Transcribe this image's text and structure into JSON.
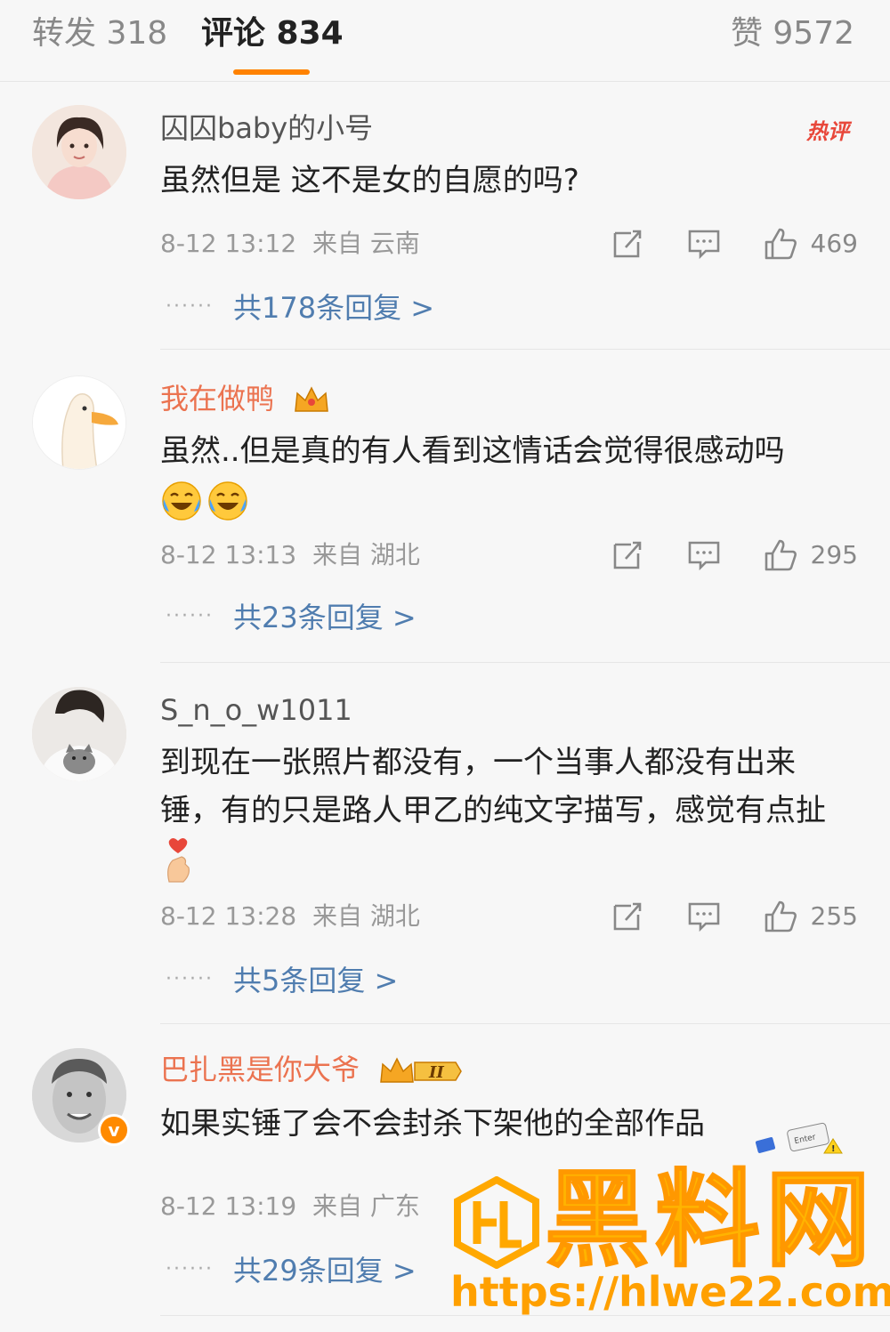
{
  "tabs": {
    "repost": "转发 318",
    "comments": "评论 834",
    "likes": "赞 9572"
  },
  "accent": "#ff8200",
  "comments": [
    {
      "username": "囚囚baby的小号",
      "hot_badge": "热评",
      "text": "虽然但是 这不是女的自愿的吗?",
      "time": "8-12 13:12",
      "source": "来自 云南",
      "likes": "469",
      "replies": "共178条回复 >"
    },
    {
      "username": "我在做鸭",
      "text": "虽然..但是真的有人看到这情话会觉得很感动吗",
      "time": "8-12 13:13",
      "source": "来自 湖北",
      "likes": "295",
      "replies": "共23条回复 >"
    },
    {
      "username": "S_n_o_w1011",
      "text": "到现在一张照片都没有，一个当事人都没有出来锤，有的只是路人甲乙的纯文字描写，感觉有点扯",
      "time": "8-12 13:28",
      "source": "来自 湖北",
      "likes": "255",
      "replies": "共5条回复 >"
    },
    {
      "username": "巴扎黑是你大爷",
      "text": "如果实锤了会不会封杀下架他的全部作品",
      "time": "8-12 13:19",
      "source": "来自 广东",
      "replies": "共29条回复 >"
    }
  ],
  "watermark": {
    "title": "黑料网",
    "url": "https://hlwe22.com"
  },
  "icons": [
    "repost-icon",
    "comment-icon",
    "like-icon",
    "crown-icon",
    "v-badge-icon",
    "laughing-tears-emoji",
    "finger-heart-emoji"
  ]
}
